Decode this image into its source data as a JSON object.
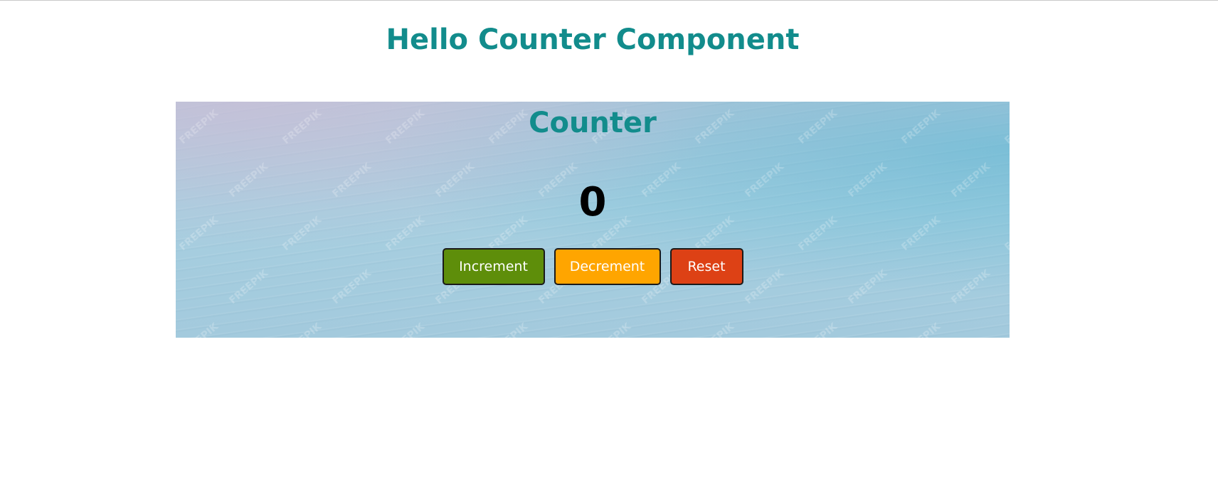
{
  "page": {
    "title": "Hello Counter Component"
  },
  "counter": {
    "title": "Counter",
    "value": "0",
    "buttons": {
      "increment": "Increment",
      "decrement": "Decrement",
      "reset": "Reset"
    }
  },
  "background": {
    "watermark": "FREEPIK"
  },
  "colors": {
    "title": "#128c8c",
    "increment": "#5e8e0a",
    "decrement": "#ffa500",
    "reset": "#dd4115",
    "count": "#000000"
  }
}
